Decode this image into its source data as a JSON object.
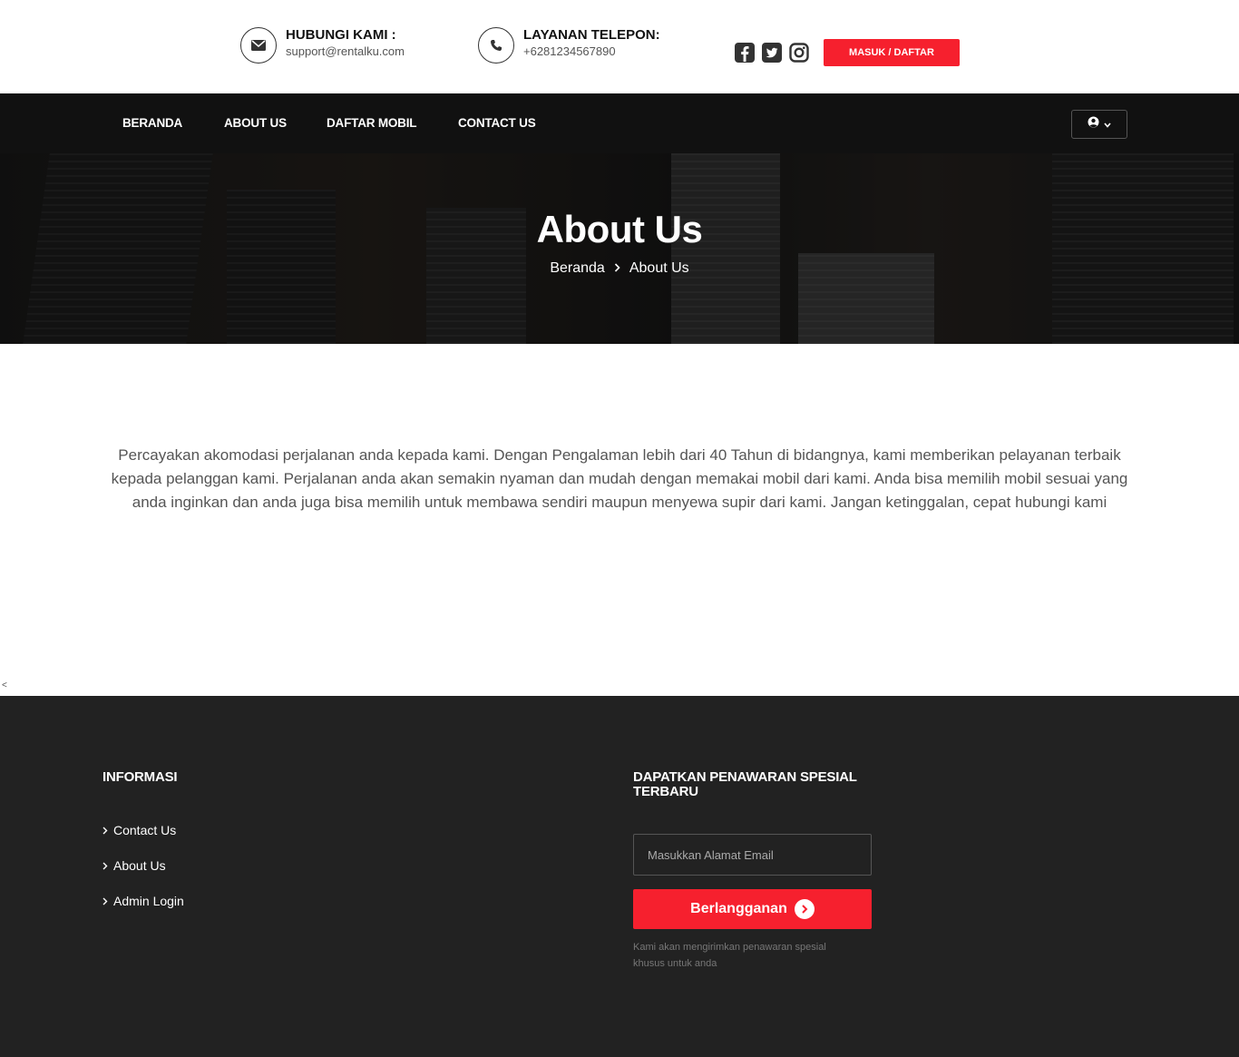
{
  "header": {
    "contact_label": "HUBUNGI KAMI :",
    "contact_value": "support@rentalku.com",
    "phone_label": "LAYANAN TELEPON:",
    "phone_value": "+6281234567890",
    "social_icons": [
      "facebook-icon",
      "twitter-icon",
      "instagram-icon"
    ],
    "login_button": "MASUK / DAFTAR"
  },
  "nav": {
    "items": [
      {
        "label": "BERANDA"
      },
      {
        "label": "ABOUT US"
      },
      {
        "label": "DAFTAR MOBIL"
      },
      {
        "label": "CONTACT US"
      }
    ]
  },
  "hero": {
    "title": "About Us",
    "breadcrumb": [
      "Beranda",
      "About Us"
    ]
  },
  "content": {
    "about_text": "Percayakan akomodasi perjalanan anda kepada kami. Dengan Pengalaman lebih dari 40 Tahun di bidangnya, kami memberikan pelayanan terbaik kepada pelanggan kami. Perjalanan anda akan semakin nyaman dan mudah dengan memakai mobil dari kami. Anda bisa memilih mobil sesuai yang anda inginkan dan anda juga bisa memilih untuk membawa sendiri maupun menyewa supir dari kami. Jangan ketinggalan, cepat hubungi kami",
    "stray_char": "<"
  },
  "footer": {
    "info_heading": "INFORMASI",
    "links": [
      {
        "label": "Contact Us"
      },
      {
        "label": "About Us"
      },
      {
        "label": "Admin Login"
      }
    ],
    "newsletter_heading": "DAPATKAN PENAWARAN SPESIAL TERBARU",
    "email_placeholder": "Masukkan Alamat Email",
    "subscribe_button": "Berlangganan",
    "note": "Kami akan mengirimkan penawaran spesial khusus untuk anda"
  },
  "colors": {
    "accent": "#f6202e",
    "nav_bg": "#111111",
    "footer_bg": "#222222"
  }
}
